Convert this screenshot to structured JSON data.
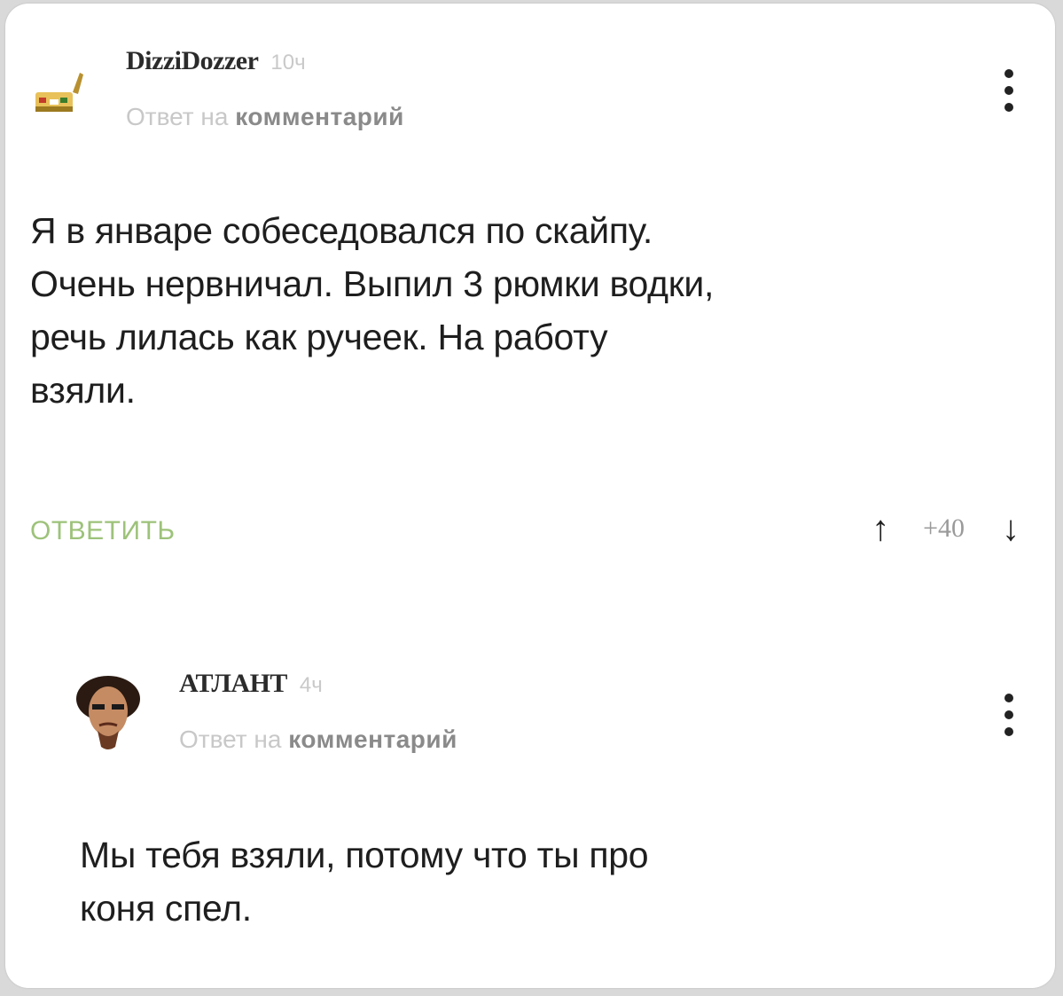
{
  "comments": [
    {
      "author": "DizziDozzer",
      "time": "10ч",
      "reply_prefix": "Ответ на",
      "reply_target": "комментарий",
      "avatar_icon": "cat-avatar-icon",
      "lines": [
        "Я в январе собеседовался по скайпу.",
        "Очень нервничал. Выпил 3 рюмки водки,",
        "речь лилась как ручеек. На работу",
        "взяли."
      ],
      "reply_button": "ОТВЕТИТЬ",
      "upvote_icon": "↑",
      "score": "+40",
      "downvote_icon": "↓"
    },
    {
      "author": "АТЛАНТ",
      "time": "4ч",
      "reply_prefix": "Ответ на",
      "reply_target": "комментарий",
      "avatar_icon": "face-avatar-icon",
      "lines": [
        "Мы тебя взяли, потому что ты про",
        "коня спел."
      ]
    }
  ],
  "colors": {
    "reply_button": "#9dc27a",
    "muted_text": "#c8c8c8",
    "body_text": "#1e1e1e"
  }
}
